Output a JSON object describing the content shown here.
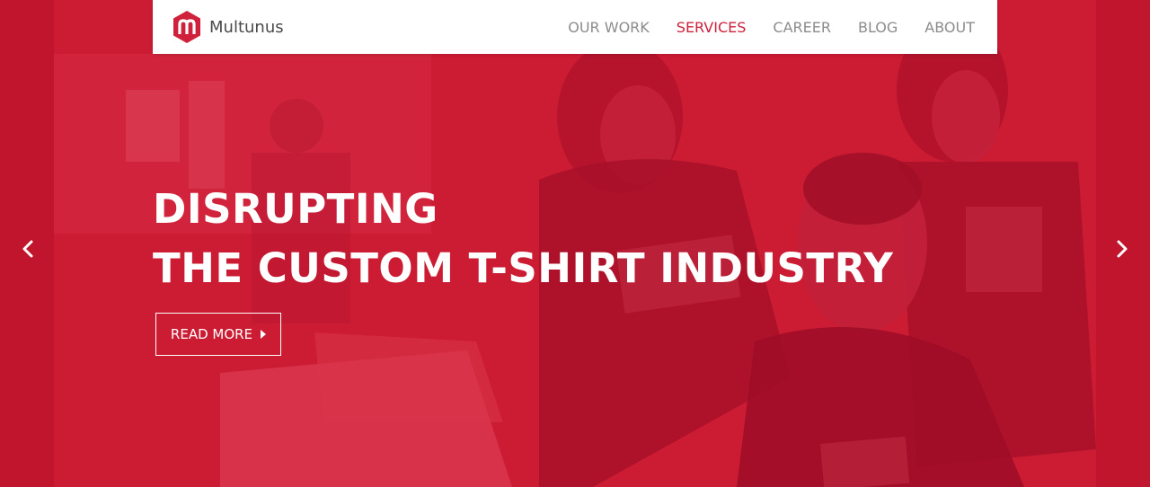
{
  "brand": {
    "name": "Multunus",
    "color": "#d0213c"
  },
  "nav": {
    "items": [
      {
        "label": "OUR WORK",
        "active": false
      },
      {
        "label": "SERVICES",
        "active": true
      },
      {
        "label": "CAREER",
        "active": false
      },
      {
        "label": "BLOG",
        "active": false
      },
      {
        "label": "ABOUT",
        "active": false
      }
    ],
    "active_color": "#d0213c",
    "inactive_color": "#8c8c8c"
  },
  "hero": {
    "headline_line1": "DISRUPTING",
    "headline_line2": "THE CUSTOM T-SHIRT INDUSTRY",
    "cta_label": "READ MORE",
    "overlay_color": "#cc1c34",
    "prev_icon": "chevron-left-icon",
    "next_icon": "chevron-right-icon"
  }
}
